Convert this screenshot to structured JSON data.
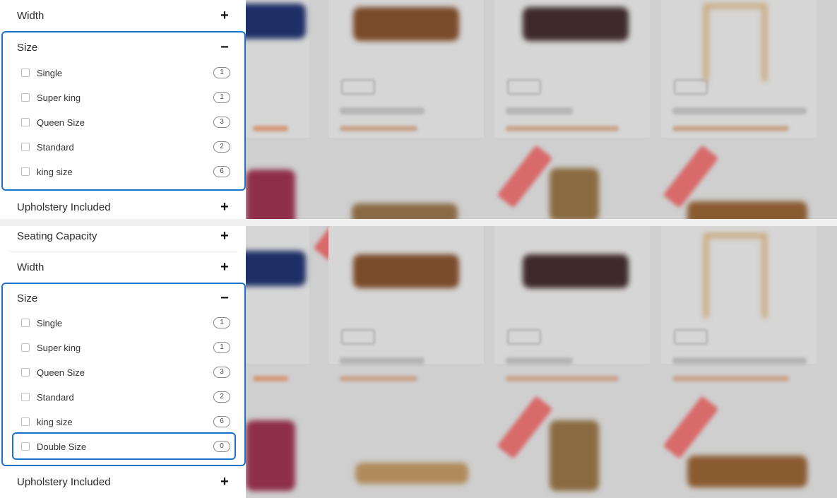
{
  "top": {
    "width": {
      "label": "Width",
      "sign": "+"
    },
    "size": {
      "label": "Size",
      "sign": "−",
      "options": [
        {
          "label": "Single",
          "count": "1"
        },
        {
          "label": "Super king",
          "count": "1"
        },
        {
          "label": "Queen Size",
          "count": "3"
        },
        {
          "label": "Standard",
          "count": "2"
        },
        {
          "label": "king size",
          "count": "6"
        }
      ]
    },
    "upholstery": {
      "label": "Upholstery Included",
      "sign": "+"
    }
  },
  "bottom": {
    "seating": {
      "label": "Seating Capacity",
      "sign": "+"
    },
    "width": {
      "label": "Width",
      "sign": "+"
    },
    "size": {
      "label": "Size",
      "sign": "−",
      "options": [
        {
          "label": "Single",
          "count": "1"
        },
        {
          "label": "Super king",
          "count": "1"
        },
        {
          "label": "Queen Size",
          "count": "3"
        },
        {
          "label": "Standard",
          "count": "2"
        },
        {
          "label": "king size",
          "count": "6"
        },
        {
          "label": "Double Size",
          "count": "0"
        }
      ]
    },
    "upholstery": {
      "label": "Upholstery Included",
      "sign": "+"
    }
  },
  "colors": {
    "highlight": "#1a73c8",
    "overlay": "#cfcfcf"
  }
}
